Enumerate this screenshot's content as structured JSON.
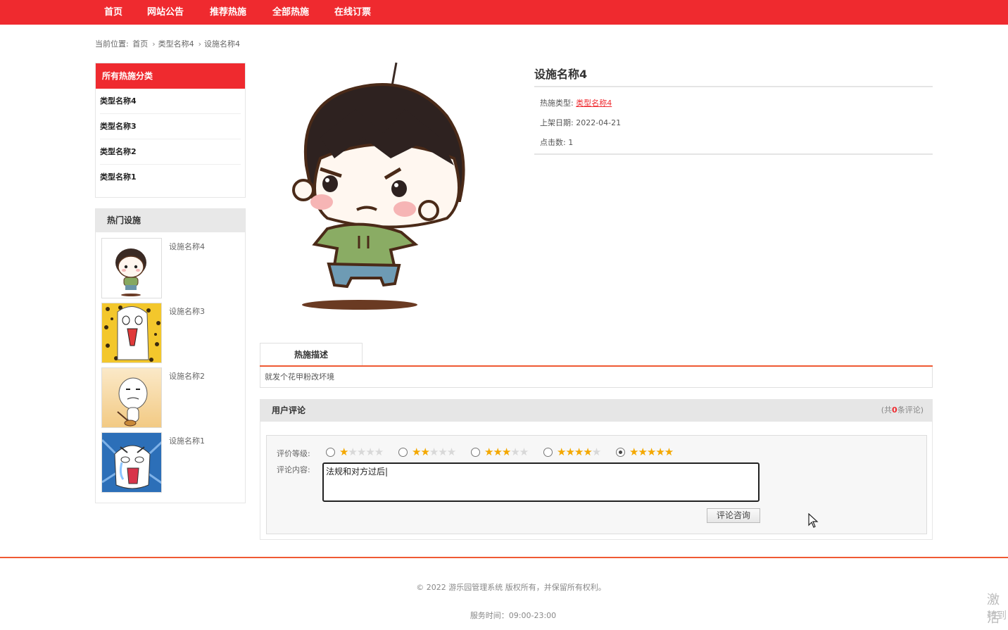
{
  "nav": {
    "items": [
      "首页",
      "网站公告",
      "推荐热施",
      "全部热施",
      "在线订票"
    ]
  },
  "breadcrumb": {
    "prefix": "当前位置:",
    "items": [
      "首页",
      "类型名称4",
      "设施名称4"
    ]
  },
  "sidebar": {
    "categories_title": "所有热施分类",
    "categories": [
      "类型名称4",
      "类型名称3",
      "类型名称2",
      "类型名称1"
    ],
    "hot_title": "热门设施",
    "hot_items": [
      {
        "name": "设施名称4"
      },
      {
        "name": "设施名称3"
      },
      {
        "name": "设施名称2"
      },
      {
        "name": "设施名称1"
      }
    ]
  },
  "detail": {
    "title": "设施名称4",
    "type_label": "热施类型:",
    "type_value": "类型名称4",
    "date_label": "上架日期:",
    "date_value": "2022-04-21",
    "clicks_label": "点击数:",
    "clicks_value": "1"
  },
  "description": {
    "tab_label": "热施描述",
    "text": "就发个花甲粉改坏境"
  },
  "reviews": {
    "title": "用户评论",
    "count_prefix": "(共",
    "count": "0",
    "count_suffix": "条评论)",
    "rating_label": "评价等级:",
    "content_label": "评论内容:",
    "content_value": "法规和对方过后|",
    "selected_rating": 5,
    "submit_label": "评论咨询"
  },
  "footer": {
    "copyright": "© 2022 游乐园管理系统 版权所有，并保留所有权利。",
    "hours": "服务时间：09:00-23:00"
  },
  "watermark": {
    "line1": "激活",
    "line2": "转到"
  },
  "colors": {
    "brand": "#ef2a2f",
    "accent_line": "#ef5a33",
    "star": "#f4a800"
  }
}
